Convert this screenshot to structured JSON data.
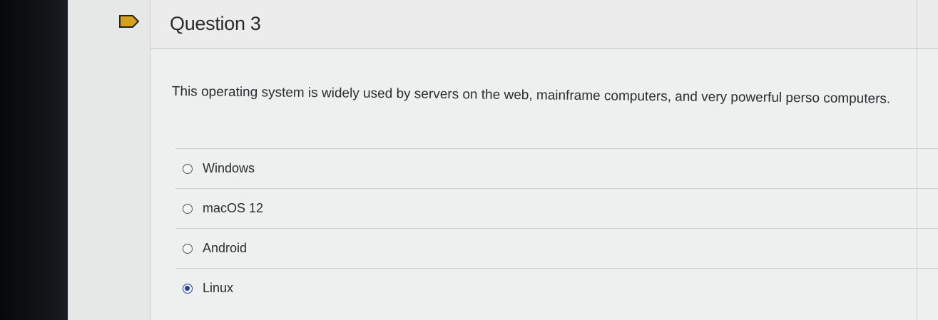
{
  "question": {
    "title": "Question 3",
    "text": "This operating system is widely used by servers on the web, mainframe computers, and very powerful perso computers."
  },
  "answers": [
    {
      "label": "Windows",
      "selected": false
    },
    {
      "label": "macOS 12",
      "selected": false
    },
    {
      "label": "Android",
      "selected": false
    },
    {
      "label": "Linux",
      "selected": true
    }
  ],
  "colors": {
    "flag": "#d6a21a",
    "radio_selected": "#1f3e9a"
  }
}
